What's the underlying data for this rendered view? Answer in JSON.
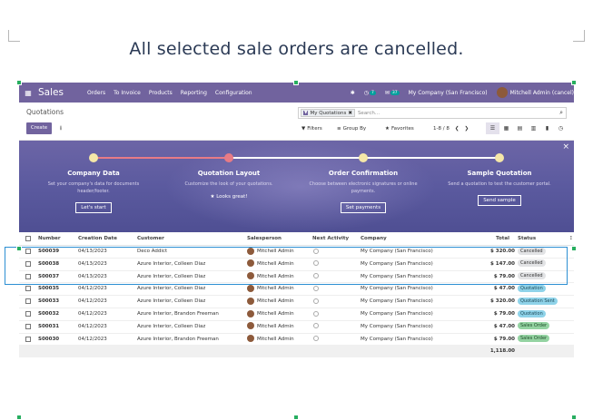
{
  "caption": "All selected sale orders are cancelled.",
  "navbar": {
    "app_title": "Sales",
    "menu": [
      "Orders",
      "To Invoice",
      "Products",
      "Reporting",
      "Configuration"
    ],
    "activity_badge": "7",
    "chat_badge": "37",
    "company": "My Company (San Francisco)",
    "user": "Mitchell Admin (cancel)"
  },
  "control_panel": {
    "breadcrumb": "Quotations",
    "create_label": "Create",
    "search_facet": "My Quotations",
    "search_placeholder": "Search...",
    "filters_label": "Filters",
    "groupby_label": "Group By",
    "favorites_label": "Favorites",
    "pager": "1-8 / 8"
  },
  "onboarding": {
    "steps": [
      {
        "title": "Company Data",
        "desc": "Set your company's data for documents header/footer.",
        "button": "Let's start",
        "done": ""
      },
      {
        "title": "Quotation Layout",
        "desc": "Customize the look of your quotations.",
        "button": "",
        "done": "Looks great!"
      },
      {
        "title": "Order Confirmation",
        "desc": "Choose between electronic signatures or online payments.",
        "button": "Set payments",
        "done": ""
      },
      {
        "title": "Sample Quotation",
        "desc": "Send a quotation to test the customer portal.",
        "button": "Send sample",
        "done": ""
      }
    ]
  },
  "table": {
    "headers": {
      "number": "Number",
      "date": "Creation Date",
      "customer": "Customer",
      "salesperson": "Salesperson",
      "activity": "Next Activity",
      "company": "Company",
      "total": "Total",
      "status": "Status"
    },
    "rows": [
      {
        "number": "S00039",
        "date": "04/13/2023",
        "customer": "Deco Addict",
        "salesperson": "Mitchell Admin",
        "company": "My Company (San Francisco)",
        "total": "$ 320.00",
        "status": "Cancelled",
        "status_kind": "cancelled"
      },
      {
        "number": "S00038",
        "date": "04/13/2023",
        "customer": "Azure Interior, Colleen Diaz",
        "salesperson": "Mitchell Admin",
        "company": "My Company (San Francisco)",
        "total": "$ 147.00",
        "status": "Cancelled",
        "status_kind": "cancelled"
      },
      {
        "number": "S00037",
        "date": "04/13/2023",
        "customer": "Azure Interior, Colleen Diaz",
        "salesperson": "Mitchell Admin",
        "company": "My Company (San Francisco)",
        "total": "$ 79.00",
        "status": "Cancelled",
        "status_kind": "cancelled"
      },
      {
        "number": "S00035",
        "date": "04/12/2023",
        "customer": "Azure Interior, Colleen Diaz",
        "salesperson": "Mitchell Admin",
        "company": "My Company (San Francisco)",
        "total": "$ 47.00",
        "status": "Quotation",
        "status_kind": "quotation"
      },
      {
        "number": "S00033",
        "date": "04/12/2023",
        "customer": "Azure Interior, Colleen Diaz",
        "salesperson": "Mitchell Admin",
        "company": "My Company (San Francisco)",
        "total": "$ 320.00",
        "status": "Quotation Sent",
        "status_kind": "sent"
      },
      {
        "number": "S00032",
        "date": "04/12/2023",
        "customer": "Azure Interior, Brandon Freeman",
        "salesperson": "Mitchell Admin",
        "company": "My Company (San Francisco)",
        "total": "$ 79.00",
        "status": "Quotation",
        "status_kind": "quotation"
      },
      {
        "number": "S00031",
        "date": "04/12/2023",
        "customer": "Azure Interior, Colleen Diaz",
        "salesperson": "Mitchell Admin",
        "company": "My Company (San Francisco)",
        "total": "$ 47.00",
        "status": "Sales Order",
        "status_kind": "order"
      },
      {
        "number": "S00030",
        "date": "04/12/2023",
        "customer": "Azure Interior, Brandon Freeman",
        "salesperson": "Mitchell Admin",
        "company": "My Company (San Francisco)",
        "total": "$ 79.00",
        "status": "Sales Order",
        "status_kind": "order"
      }
    ],
    "sum_total": "1,118.00"
  },
  "colors": {
    "brand": "#71639e",
    "selection": "#2d8fd3",
    "handles": "#27ae60"
  }
}
